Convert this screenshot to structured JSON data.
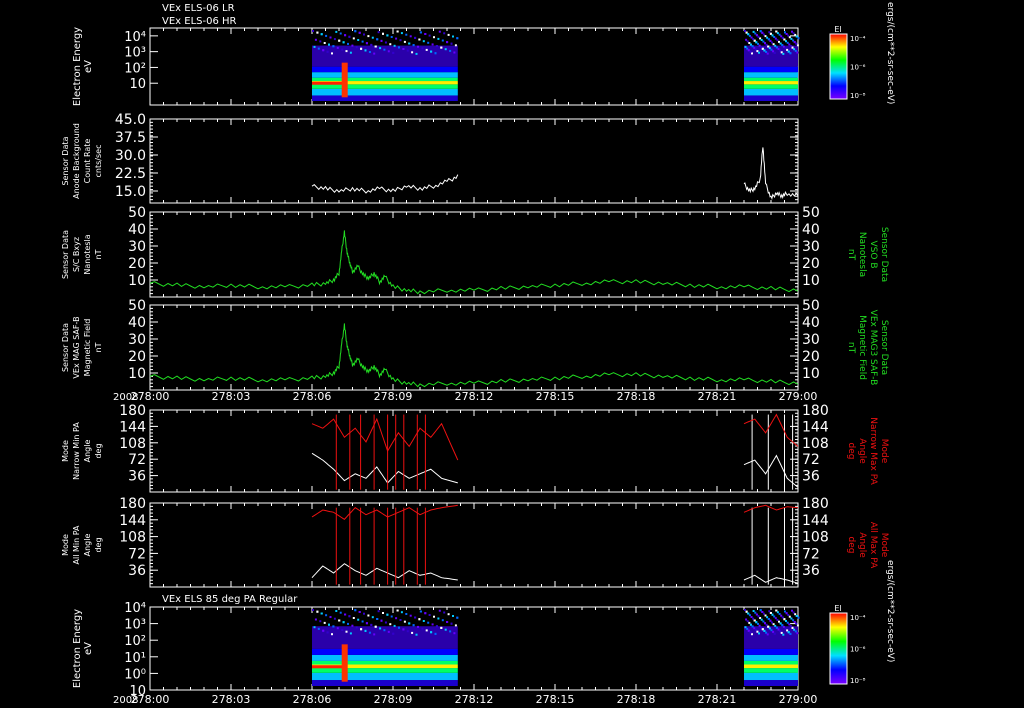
{
  "header": {
    "line1": "VEx ELS-06 LR",
    "line2": "VEx ELS-06 HR"
  },
  "colors": {
    "white": "#ffffff",
    "green": "#22dd22",
    "red": "#ee1111",
    "bg": "#000000"
  },
  "x_axis": {
    "year": "2008",
    "ticks": [
      "278:00",
      "278:03",
      "278:06",
      "278:09",
      "278:12",
      "278:15",
      "278:18",
      "278:21",
      "279:00"
    ]
  },
  "chart_data": [
    {
      "type": "heatmap",
      "ylabel": [
        "Electron Energy",
        "eV"
      ],
      "ytick_labels": [
        "10",
        "10²",
        "10³",
        "10⁴"
      ],
      "log_scale": true,
      "data_spans": [
        [
          "278:06",
          "278:11.4"
        ],
        [
          "278:22",
          "279:00"
        ]
      ],
      "colorbar": {
        "label": "El",
        "ticks": [
          "10⁻⁴",
          "10⁻⁶",
          "10⁻⁸"
        ]
      },
      "units_label": "ergs/(cm**2-sr-sec-eV)"
    },
    {
      "type": "line",
      "ylabel": [
        "Sensor Data",
        "Anode Background",
        "Count Rate",
        "cnts/sec"
      ],
      "yticks": [
        "15.0",
        "22.5",
        "30.0",
        "37.5",
        "45.0"
      ],
      "ylim": [
        10,
        45
      ],
      "series": [
        {
          "x": [
            6.0,
            6.5,
            7.0,
            7.5,
            8.0,
            8.5,
            9.0,
            9.5,
            10.0,
            10.5,
            11.0,
            11.4,
            22.0,
            22.2,
            22.4,
            22.6,
            22.7,
            22.8,
            23.0,
            23.2,
            23.4,
            23.6,
            24.0
          ],
          "y": [
            17,
            16,
            15,
            16,
            15,
            16,
            15,
            17,
            16,
            17,
            19,
            21,
            18,
            15,
            16,
            20,
            34,
            18,
            12,
            14,
            13,
            14,
            13
          ]
        }
      ]
    },
    {
      "type": "line",
      "ylabel": [
        "Sensor Data",
        "S/C Bxyz",
        "Nanotesla",
        "nT"
      ],
      "ylabel_right": [
        "Sensor Data",
        "VSO B",
        "Nanotesla",
        "nT"
      ],
      "yticks": [
        "10",
        "20",
        "30",
        "40",
        "50"
      ],
      "ylim": [
        0,
        50
      ],
      "series": [
        {
          "x": [
            0,
            1,
            2,
            3,
            4,
            5,
            6,
            6.5,
            6.8,
            7.0,
            7.1,
            7.2,
            7.3,
            7.4,
            7.5,
            7.7,
            7.9,
            8.1,
            8.3,
            8.5,
            8.7,
            9.0,
            9.5,
            10,
            11,
            12,
            13,
            14,
            15,
            16,
            17,
            18,
            19,
            20,
            21,
            22,
            23,
            24
          ],
          "y": [
            8,
            7,
            6,
            7,
            6,
            6,
            7,
            8,
            10,
            14,
            27,
            38,
            26,
            20,
            15,
            18,
            13,
            11,
            14,
            9,
            12,
            6,
            4,
            3,
            4,
            4,
            5,
            6,
            7,
            8,
            9,
            9,
            8,
            7,
            6,
            6,
            5,
            4
          ]
        }
      ]
    },
    {
      "type": "line",
      "ylabel": [
        "Sensor Data",
        "VEx MAG SAF-B",
        "Magnetic Field",
        "nT"
      ],
      "ylabel_right": [
        "Sensor Data",
        "VEx MAG3 SAF-B",
        "Magnetic Field",
        "nT"
      ],
      "yticks": [
        "10",
        "20",
        "30",
        "40",
        "50"
      ],
      "ylim": [
        0,
        50
      ],
      "series": [
        {
          "x": [
            0,
            1,
            2,
            3,
            4,
            5,
            6,
            6.5,
            6.8,
            7.0,
            7.1,
            7.2,
            7.3,
            7.4,
            7.5,
            7.7,
            7.9,
            8.1,
            8.3,
            8.5,
            8.7,
            9.0,
            9.5,
            10,
            11,
            12,
            13,
            14,
            15,
            16,
            17,
            18,
            19,
            20,
            21,
            22,
            23,
            24
          ],
          "y": [
            8,
            7,
            6,
            7,
            6,
            6,
            7,
            8,
            10,
            14,
            27,
            38,
            26,
            20,
            15,
            18,
            13,
            11,
            14,
            9,
            12,
            6,
            4,
            3,
            4,
            4,
            5,
            6,
            7,
            8,
            9,
            9,
            8,
            7,
            6,
            6,
            5,
            4
          ]
        }
      ]
    },
    {
      "type": "line",
      "ylabel": [
        "Mode",
        "Narrow Min PA",
        "Angle",
        "deg"
      ],
      "ylabel_right": [
        "Mode",
        "Narrow Max PA",
        "Angle",
        "deg"
      ],
      "yticks": [
        "36",
        "72",
        "108",
        "144",
        "180"
      ],
      "ylim": [
        0,
        180
      ],
      "series": [
        {
          "name": "min",
          "x": [
            6.0,
            6.4,
            6.8,
            7.2,
            7.6,
            8.0,
            8.4,
            8.8,
            9.2,
            9.6,
            10.0,
            10.4,
            10.8,
            11.4,
            22.0,
            22.4,
            22.8,
            23.2,
            23.6,
            24.0
          ],
          "y": [
            85,
            70,
            50,
            25,
            40,
            30,
            55,
            20,
            45,
            30,
            40,
            50,
            30,
            20,
            60,
            70,
            40,
            80,
            30,
            10
          ]
        },
        {
          "name": "max",
          "x": [
            6.0,
            6.4,
            6.8,
            7.2,
            7.6,
            8.0,
            8.4,
            8.8,
            9.2,
            9.6,
            10.0,
            10.4,
            10.8,
            11.4,
            22.0,
            22.4,
            22.8,
            23.2,
            23.6,
            24.0
          ],
          "y": [
            150,
            140,
            160,
            120,
            140,
            110,
            160,
            90,
            130,
            100,
            140,
            120,
            150,
            70,
            150,
            160,
            130,
            170,
            120,
            100
          ]
        }
      ]
    },
    {
      "type": "line",
      "ylabel": [
        "Mode",
        "All Min PA",
        "Angle",
        "deg"
      ],
      "ylabel_right": [
        "Mode",
        "All Max PA",
        "Angle",
        "deg"
      ],
      "yticks": [
        "36",
        "72",
        "108",
        "144",
        "180"
      ],
      "ylim": [
        0,
        180
      ],
      "series": [
        {
          "name": "min",
          "x": [
            6.0,
            6.4,
            6.8,
            7.2,
            7.6,
            8.0,
            8.4,
            8.8,
            9.2,
            9.6,
            10.0,
            10.4,
            10.8,
            11.4,
            22.0,
            22.4,
            22.8,
            23.2,
            23.6,
            24.0
          ],
          "y": [
            20,
            45,
            30,
            50,
            35,
            25,
            40,
            30,
            20,
            35,
            25,
            30,
            20,
            15,
            15,
            25,
            10,
            20,
            15,
            8
          ]
        },
        {
          "name": "max",
          "x": [
            6.0,
            6.4,
            6.8,
            7.2,
            7.6,
            8.0,
            8.4,
            8.8,
            9.2,
            9.6,
            10.0,
            10.4,
            10.8,
            11.4,
            22.0,
            22.4,
            22.8,
            23.2,
            23.6,
            24.0
          ],
          "y": [
            150,
            165,
            160,
            145,
            170,
            155,
            165,
            150,
            160,
            170,
            155,
            165,
            170,
            175,
            160,
            170,
            175,
            165,
            172,
            170
          ]
        }
      ]
    },
    {
      "type": "heatmap",
      "title": "VEx ELS 85 deg PA Regular",
      "ylabel": [
        "Electron Energy",
        "eV"
      ],
      "ytick_labels": [
        "10",
        "10⁰",
        "10¹",
        "10²",
        "10³",
        "10⁴"
      ],
      "log_scale": true,
      "data_spans": [
        [
          "278:06",
          "278:11.4"
        ],
        [
          "278:22",
          "279:00"
        ]
      ],
      "colorbar": {
        "label": "El",
        "ticks": [
          "10⁻⁴",
          "10⁻⁶",
          "10⁻⁸"
        ]
      },
      "units_label": "ergs/(cm**2-sr-sec-eV)"
    }
  ]
}
